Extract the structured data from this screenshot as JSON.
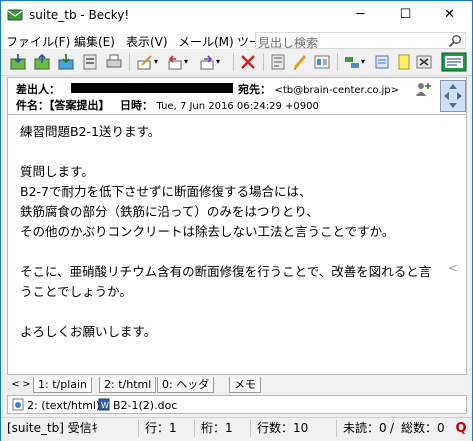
{
  "window": {
    "title": "suite_tb - Becky!",
    "minimize_glyph": "─",
    "maximize_glyph": "☐",
    "close_glyph": "✕"
  },
  "menu": {
    "items": [
      "ファイル(F)",
      "編集(E)",
      "表示(V)",
      "メール(M)",
      "ツー"
    ],
    "search_placeholder": "見出し検索"
  },
  "toolbar": {
    "icons": [
      "receive-icon",
      "send-icon",
      "receive-all-icon",
      "address-book-icon",
      "print-icon",
      "compose-icon",
      "reply-icon",
      "forward-icon",
      "delete-icon",
      "filter-icon",
      "edit-icon",
      "settings-icon",
      "view-icon",
      "mailbox-icon",
      "note-icon",
      "cancel-icon"
    ]
  },
  "header": {
    "from_label": "差出人：",
    "to_label": "宛先：",
    "to_value": "<tb@brain-center.co.jp>",
    "subject_label": "件名：",
    "subject_value": "【答案提出】",
    "date_label": "日時：",
    "date_value": "Tue, 7 Jun 2016 06:24:29 +0900"
  },
  "body": {
    "lines": [
      "練習問題B2-1送ります。",
      "",
      "質問します。",
      "B2-7で耐力を低下させずに断面修復する場合には、",
      "鉄筋腐食の部分（鉄筋に沿って）のみをはつりとり、",
      "その他のかぶりコンクリートは除去しない工法と言うことですか。",
      "",
      "そこに、亜硝酸リチウム含有の断面修復を行うことで、改善を図れると言",
      "うことでしょうか。",
      "",
      "よろしくお願いします。"
    ],
    "wrap_marker": "<"
  },
  "tabs": {
    "scroll_left": "<",
    "scroll_right": ">",
    "items": [
      "1: t/plain",
      "2: t/html",
      "0: ヘッダ",
      "メモ"
    ]
  },
  "attachments": {
    "items": [
      "2: (text/html)",
      "B2-1(2).doc"
    ]
  },
  "status": {
    "folder": "[suite_tb] 受信ｷ",
    "line_label": "行：1",
    "col_label": "桁：1",
    "lines_label": "行数：10",
    "unread_label": "未読：",
    "unread_count": "0",
    "total_label": "総数：",
    "total_count": "0",
    "q_glyph": "Q"
  },
  "colors": {
    "border_accent": "#1979ca",
    "status_red": "#c00000"
  }
}
